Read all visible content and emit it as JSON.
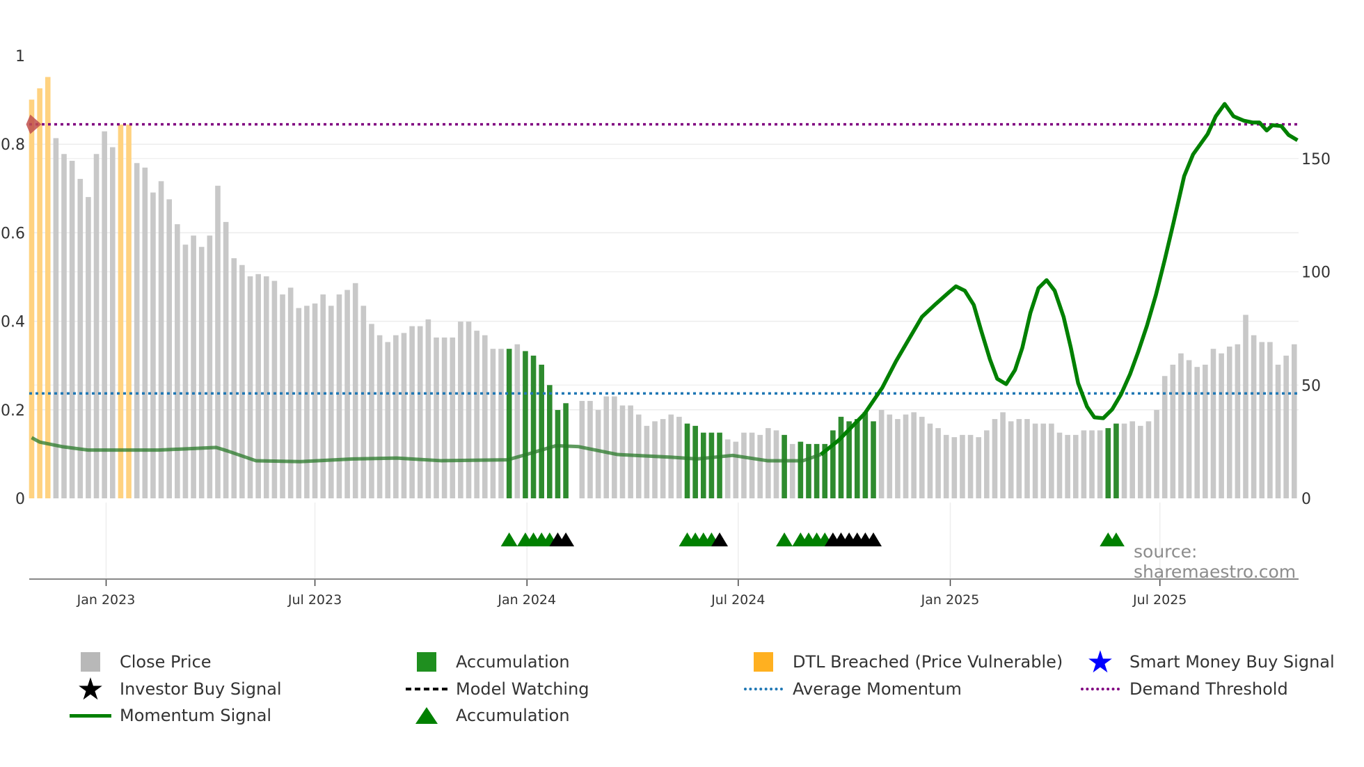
{
  "chart_data": {
    "type": "bar",
    "x_unit": "week index",
    "x_ticks": [
      {
        "label": "Jan 2023",
        "index": 10.2
      },
      {
        "label": "Jul 2023",
        "index": 36.0
      },
      {
        "label": "Jan 2024",
        "index": 62.2
      },
      {
        "label": "Jul 2024",
        "index": 88.3
      },
      {
        "label": "Jan 2025",
        "index": 114.5
      },
      {
        "label": "Jul 2025",
        "index": 140.4
      }
    ],
    "left_axis": {
      "ticks": [
        "0",
        "0.2",
        "0.4",
        "0.6",
        "0.8",
        "1"
      ],
      "values": [
        0,
        0.2,
        0.4,
        0.6,
        0.8,
        1
      ],
      "ylim": [
        0,
        1
      ]
    },
    "right_axis": {
      "ticks": [
        "0",
        "50",
        "100",
        "150"
      ],
      "values": [
        0,
        50,
        100,
        150
      ],
      "ylim": [
        0,
        195.4
      ]
    },
    "close_price": [
      176,
      181,
      186,
      159,
      152,
      149,
      141,
      133,
      152,
      162,
      155,
      165,
      165,
      148,
      146,
      135,
      140,
      132,
      121,
      112,
      116,
      111,
      116,
      138,
      122,
      106,
      103,
      98,
      99,
      98,
      96,
      90,
      93,
      84,
      85,
      86,
      90,
      85,
      90,
      92,
      95,
      85,
      77,
      72,
      69,
      72,
      73,
      76,
      76,
      79,
      71,
      71,
      71,
      78,
      78,
      74,
      72,
      66,
      66,
      66,
      68,
      65,
      63,
      59,
      50,
      39,
      42,
      null,
      43,
      43,
      39,
      45,
      45,
      41,
      41,
      37,
      32,
      34,
      35,
      37,
      36,
      33,
      32,
      29,
      29,
      29,
      26,
      25,
      29,
      29,
      28,
      31,
      30,
      28,
      24,
      25,
      24,
      24,
      24,
      30,
      36,
      34,
      35,
      38,
      34,
      39,
      37,
      35,
      37,
      38,
      36,
      33,
      31,
      28,
      27,
      28,
      28,
      27,
      30,
      35,
      38,
      34,
      35,
      35,
      33,
      33,
      33,
      29,
      28,
      28,
      30,
      30,
      30,
      31,
      33,
      33,
      34,
      32,
      34,
      39,
      54,
      59,
      64,
      61,
      58,
      59,
      66,
      64,
      67,
      68,
      81,
      72,
      69,
      69,
      59,
      63,
      68
    ],
    "accumulation_bars": [
      60,
      62,
      63,
      64,
      65,
      66,
      67,
      82,
      83,
      84,
      85,
      86,
      94,
      96,
      97,
      98,
      99,
      100,
      101,
      102,
      103,
      104,
      105,
      134,
      135
    ],
    "dtl_breached_bars": [
      1,
      2,
      3,
      12,
      13
    ],
    "momentum_signal": [
      [
        1,
        0.137
      ],
      [
        2,
        0.127
      ],
      [
        4.7,
        0.117
      ],
      [
        8,
        0.109
      ],
      [
        12.3,
        0.109
      ],
      [
        16.7,
        0.109
      ],
      [
        23.8,
        0.115
      ],
      [
        25.2,
        0.107
      ],
      [
        28.7,
        0.085
      ],
      [
        34.2,
        0.083
      ],
      [
        40.7,
        0.089
      ],
      [
        46.1,
        0.091
      ],
      [
        51.6,
        0.085
      ],
      [
        59.8,
        0.087
      ],
      [
        62.5,
        0.101
      ],
      [
        65.8,
        0.119
      ],
      [
        68.5,
        0.117
      ],
      [
        73.4,
        0.099
      ],
      [
        80,
        0.093
      ],
      [
        83.2,
        0.089
      ],
      [
        87.6,
        0.097
      ],
      [
        91.9,
        0.085
      ],
      [
        96.3,
        0.085
      ],
      [
        98.5,
        0.099
      ],
      [
        100.7,
        0.131
      ],
      [
        103.9,
        0.191
      ],
      [
        106.1,
        0.25
      ],
      [
        107.8,
        0.31
      ],
      [
        109.4,
        0.36
      ],
      [
        111,
        0.41
      ],
      [
        112.7,
        0.439
      ],
      [
        114.3,
        0.465
      ],
      [
        115.2,
        0.479
      ],
      [
        116.3,
        0.469
      ],
      [
        117.4,
        0.437
      ],
      [
        118.3,
        0.38
      ],
      [
        119.4,
        0.314
      ],
      [
        120.3,
        0.27
      ],
      [
        121.4,
        0.258
      ],
      [
        122.5,
        0.29
      ],
      [
        123.4,
        0.34
      ],
      [
        124.4,
        0.419
      ],
      [
        125.4,
        0.475
      ],
      [
        126.4,
        0.493
      ],
      [
        127.4,
        0.469
      ],
      [
        128.5,
        0.41
      ],
      [
        129.4,
        0.34
      ],
      [
        130.3,
        0.26
      ],
      [
        131.4,
        0.207
      ],
      [
        132.3,
        0.183
      ],
      [
        133.4,
        0.181
      ],
      [
        134.5,
        0.201
      ],
      [
        135.6,
        0.235
      ],
      [
        136.7,
        0.28
      ],
      [
        137.7,
        0.33
      ],
      [
        138.8,
        0.39
      ],
      [
        139.9,
        0.459
      ],
      [
        141,
        0.539
      ],
      [
        142.1,
        0.624
      ],
      [
        143.4,
        0.728
      ],
      [
        144.5,
        0.777
      ],
      [
        146.3,
        0.823
      ],
      [
        147.3,
        0.863
      ],
      [
        148.4,
        0.891
      ],
      [
        149.5,
        0.863
      ],
      [
        150.8,
        0.853
      ],
      [
        151.9,
        0.849
      ],
      [
        152.7,
        0.849
      ],
      [
        153.6,
        0.831
      ],
      [
        154.3,
        0.843
      ],
      [
        155.4,
        0.841
      ],
      [
        156.3,
        0.821
      ],
      [
        157.4,
        0.809
      ]
    ],
    "average_momentum": 0.237,
    "demand_threshold": 0.845,
    "dtl_marker_index": 1,
    "accumulation_markers": [
      60,
      62,
      63,
      64,
      65,
      82,
      83,
      84,
      85,
      94,
      96,
      97,
      98,
      99,
      134,
      135
    ],
    "investor_buy_markers": [
      66,
      67,
      86,
      100,
      101,
      102,
      103,
      104,
      105
    ],
    "grid": true,
    "legend_placement": "bottom",
    "colors": {
      "close": "#c8c8c8",
      "accumulation": "#2e8b2e",
      "dtl": "#ffd280",
      "momentum": "#008000",
      "avg": "#1f77b4",
      "demand": "#800080",
      "investor": "#000000",
      "smart": "#0000ff",
      "dtl_marker": "#c0504d"
    }
  },
  "source": "source: sharemaestro.com",
  "legend": {
    "close_price": "Close Price",
    "accumulation_bar": "Accumulation",
    "dtl": "DTL Breached (Price Vulnerable)",
    "smart_money": "Smart Money Buy Signal",
    "investor_buy": "Investor Buy Signal",
    "model_watching": "Model Watching",
    "average_momentum": "Average Momentum",
    "demand_threshold": "Demand Threshold",
    "momentum_signal": "Momentum Signal",
    "accumulation_marker": "Accumulation"
  }
}
